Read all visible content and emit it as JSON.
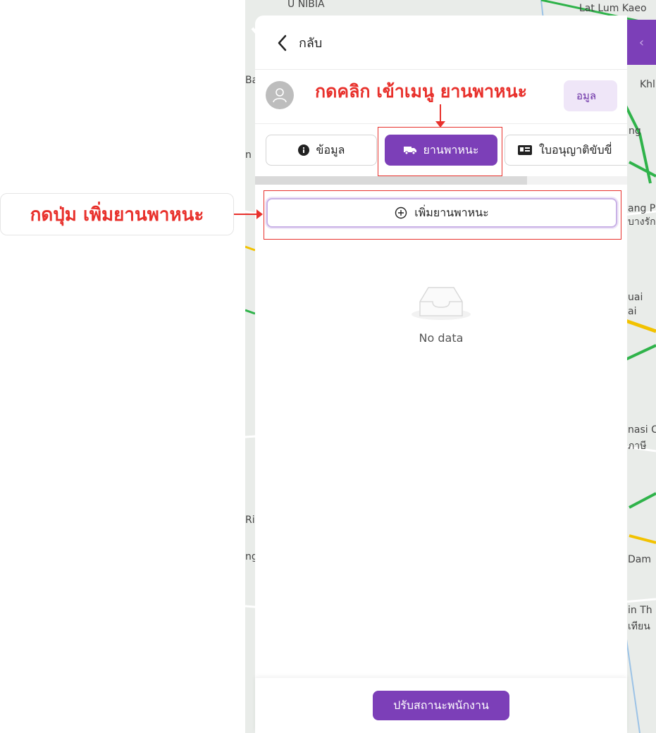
{
  "header": {
    "back_label": "กลับ"
  },
  "profile": {
    "info_chip_label": "อมูล"
  },
  "tabs": [
    {
      "label": "ข้อมูล",
      "icon": "info-circle-icon"
    },
    {
      "label": "ยานพาหนะ",
      "icon": "truck-icon",
      "active": true
    },
    {
      "label": "ใบอนุญาติขับขี่",
      "icon": "id-card-icon"
    }
  ],
  "vehicle": {
    "add_button_label": "เพิ่มยานพาหนะ",
    "empty_text": "No data"
  },
  "footer": {
    "status_button_label": "ปรับสถานะพนักงาน"
  },
  "annotations": {
    "top": "กดคลิก เข้าเมนู ยานพาหนะ",
    "left": "กดปุ่ม เพิ่มยานพาหนะ"
  },
  "map_labels": {
    "top_center": "Lat Lum Kaeo",
    "top_left": "U NIBIA",
    "right_1": "Khl",
    "right_2": "ng",
    "right_3": "ang P",
    "right_4": "บางรัก",
    "right_5": "uai",
    "right_6": "ai",
    "right_7": "nasi C",
    "right_8": "ภาษี",
    "right_9": "Dam",
    "right_10": "in Th",
    "right_11": "เทียน",
    "left_1": "Ba",
    "left_2": "n",
    "left_3": "Ri",
    "left_4": "ng"
  },
  "colors": {
    "accent": "#7c3fb8",
    "annotation": "#e8312c",
    "map_bg": "#e9ece9"
  }
}
